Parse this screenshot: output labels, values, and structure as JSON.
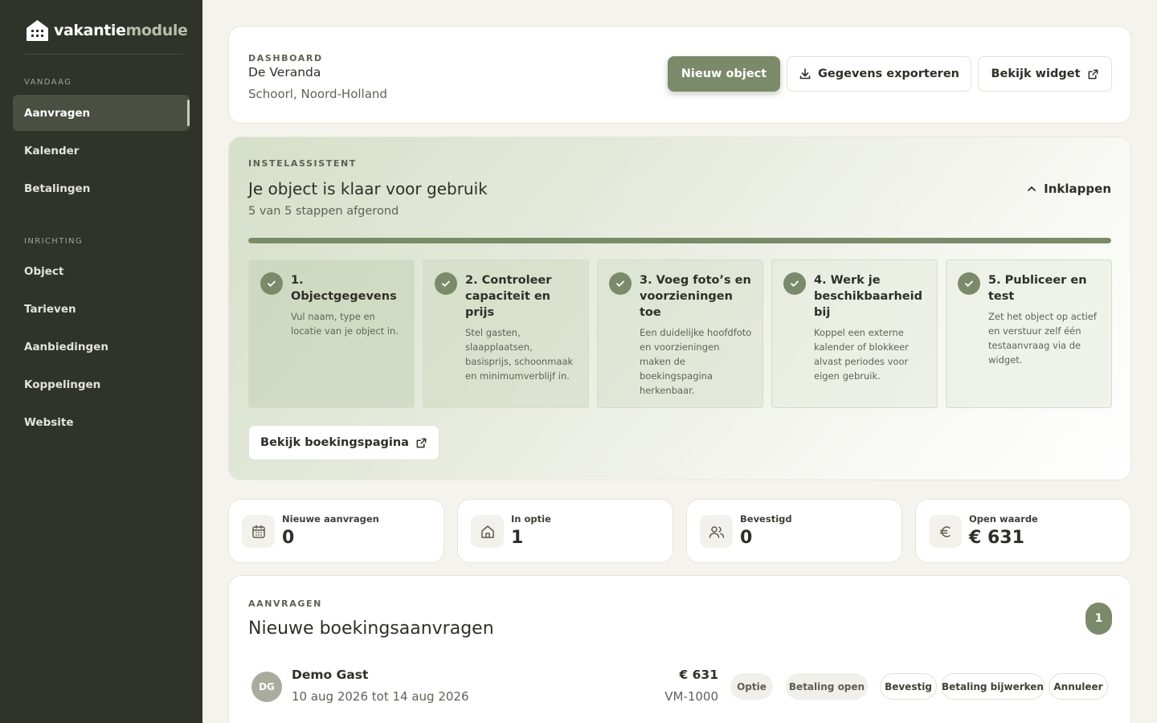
{
  "brand": {
    "name_part1": "vakantie",
    "name_part2": "module"
  },
  "sidebar": {
    "sections": [
      {
        "label": "VANDAAG",
        "items": [
          {
            "label": "Aanvragen",
            "active": true
          },
          {
            "label": "Kalender"
          },
          {
            "label": "Betalingen"
          }
        ]
      },
      {
        "label": "INRICHTING",
        "items": [
          {
            "label": "Object"
          },
          {
            "label": "Tarieven"
          },
          {
            "label": "Aanbiedingen"
          },
          {
            "label": "Koppelingen"
          },
          {
            "label": "Website"
          }
        ]
      }
    ]
  },
  "header": {
    "eyebrow": "DASHBOARD",
    "title": "De Veranda",
    "location": "Schoorl, Noord-Holland",
    "btn_new": "Nieuw object",
    "btn_export": "Gegevens exporteren",
    "btn_widget": "Bekijk widget"
  },
  "wizard": {
    "eyebrow": "INSTELASSISTENT",
    "title": "Je object is klaar voor gebruik",
    "subtitle": "5 van 5 stappen afgerond",
    "collapse": "Inklappen",
    "progress": 1.0,
    "steps": [
      {
        "title": "1. Objectgegevens",
        "desc": "Vul naam, type en locatie van je object in."
      },
      {
        "title": "2. Controleer capaciteit en prijs",
        "desc": "Stel gasten, slaapplaatsen, basisprijs, schoonmaak en minimumverblijf in."
      },
      {
        "title": "3. Voeg foto’s en voorzieningen toe",
        "desc": "Een duidelijke hoofdfoto en voorzieningen maken de boekingspagina herkenbaar."
      },
      {
        "title": "4. Werk je beschikbaarheid bij",
        "desc": "Koppel een externe kalender of blokkeer alvast periodes voor eigen gebruik."
      },
      {
        "title": "5. Publiceer en test",
        "desc": "Zet het object op actief en verstuur zelf één testaanvraag via de widget."
      }
    ],
    "booking_page_btn": "Bekijk boekingspagina"
  },
  "stats": [
    {
      "label": "Nieuwe aanvragen",
      "value": "0",
      "icon": "calendar-icon"
    },
    {
      "label": "In optie",
      "value": "1",
      "icon": "house-icon"
    },
    {
      "label": "Bevestigd",
      "value": "0",
      "icon": "users-icon"
    },
    {
      "label": "Open waarde",
      "value": "€ 631",
      "icon": "euro-icon"
    }
  ],
  "requests": {
    "eyebrow": "AANVRAGEN",
    "title": "Nieuwe boekingsaanvragen",
    "count": "1",
    "items": [
      {
        "initials": "DG",
        "name": "Demo Gast",
        "dates": "10 aug 2026 tot 14 aug 2026",
        "amount": "€ 631",
        "ref": "VM-1000",
        "status": "Optie",
        "payment": "Betaling open",
        "actions": [
          "Bevestig",
          "Betaling bijwerken",
          "Annuleer"
        ]
      }
    ]
  },
  "colors": {
    "sidebar_bg": "#2f3329",
    "accent": "#7a8a6a",
    "page_bg": "#f5f3ee"
  }
}
